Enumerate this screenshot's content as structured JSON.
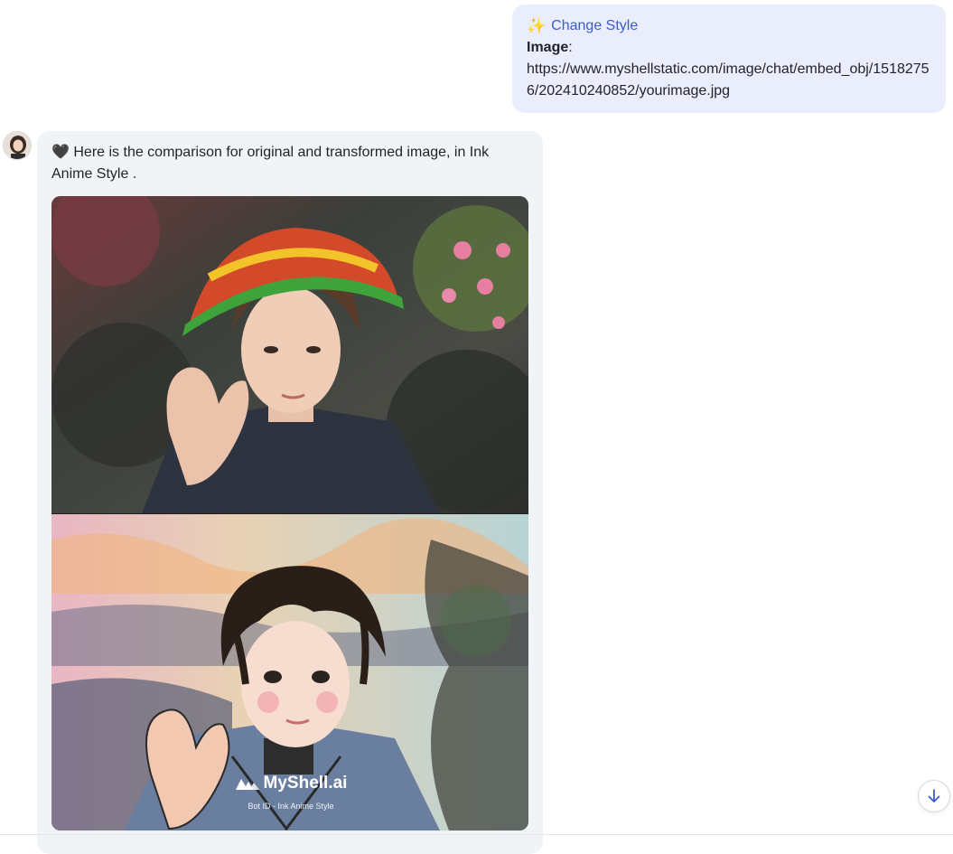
{
  "user_message": {
    "action_icon": "sparkle-icon",
    "action_label": "Change Style",
    "image_label": "Image",
    "image_colon": ":",
    "image_url": "https://www.myshellstatic.com/image/chat/embed_obj/15182756/202410240852/yourimage.jpg"
  },
  "bot_message": {
    "avatar_icon": "bot-avatar",
    "heart": "🖤",
    "text": " Here is the comparison for original and transformed image, in Ink Anime Style .",
    "image_alt": "comparison image: original photo (top), ink anime style (bottom)",
    "watermark_brand": "MyShell.ai",
    "watermark_sub": "Bot ID - Ink Anime Style"
  },
  "controls": {
    "scroll_down_icon": "arrow-down-icon"
  },
  "colors": {
    "user_bubble": "#eaedfb",
    "bot_bubble": "#f1f4f7",
    "accent": "#3d5ccc"
  }
}
